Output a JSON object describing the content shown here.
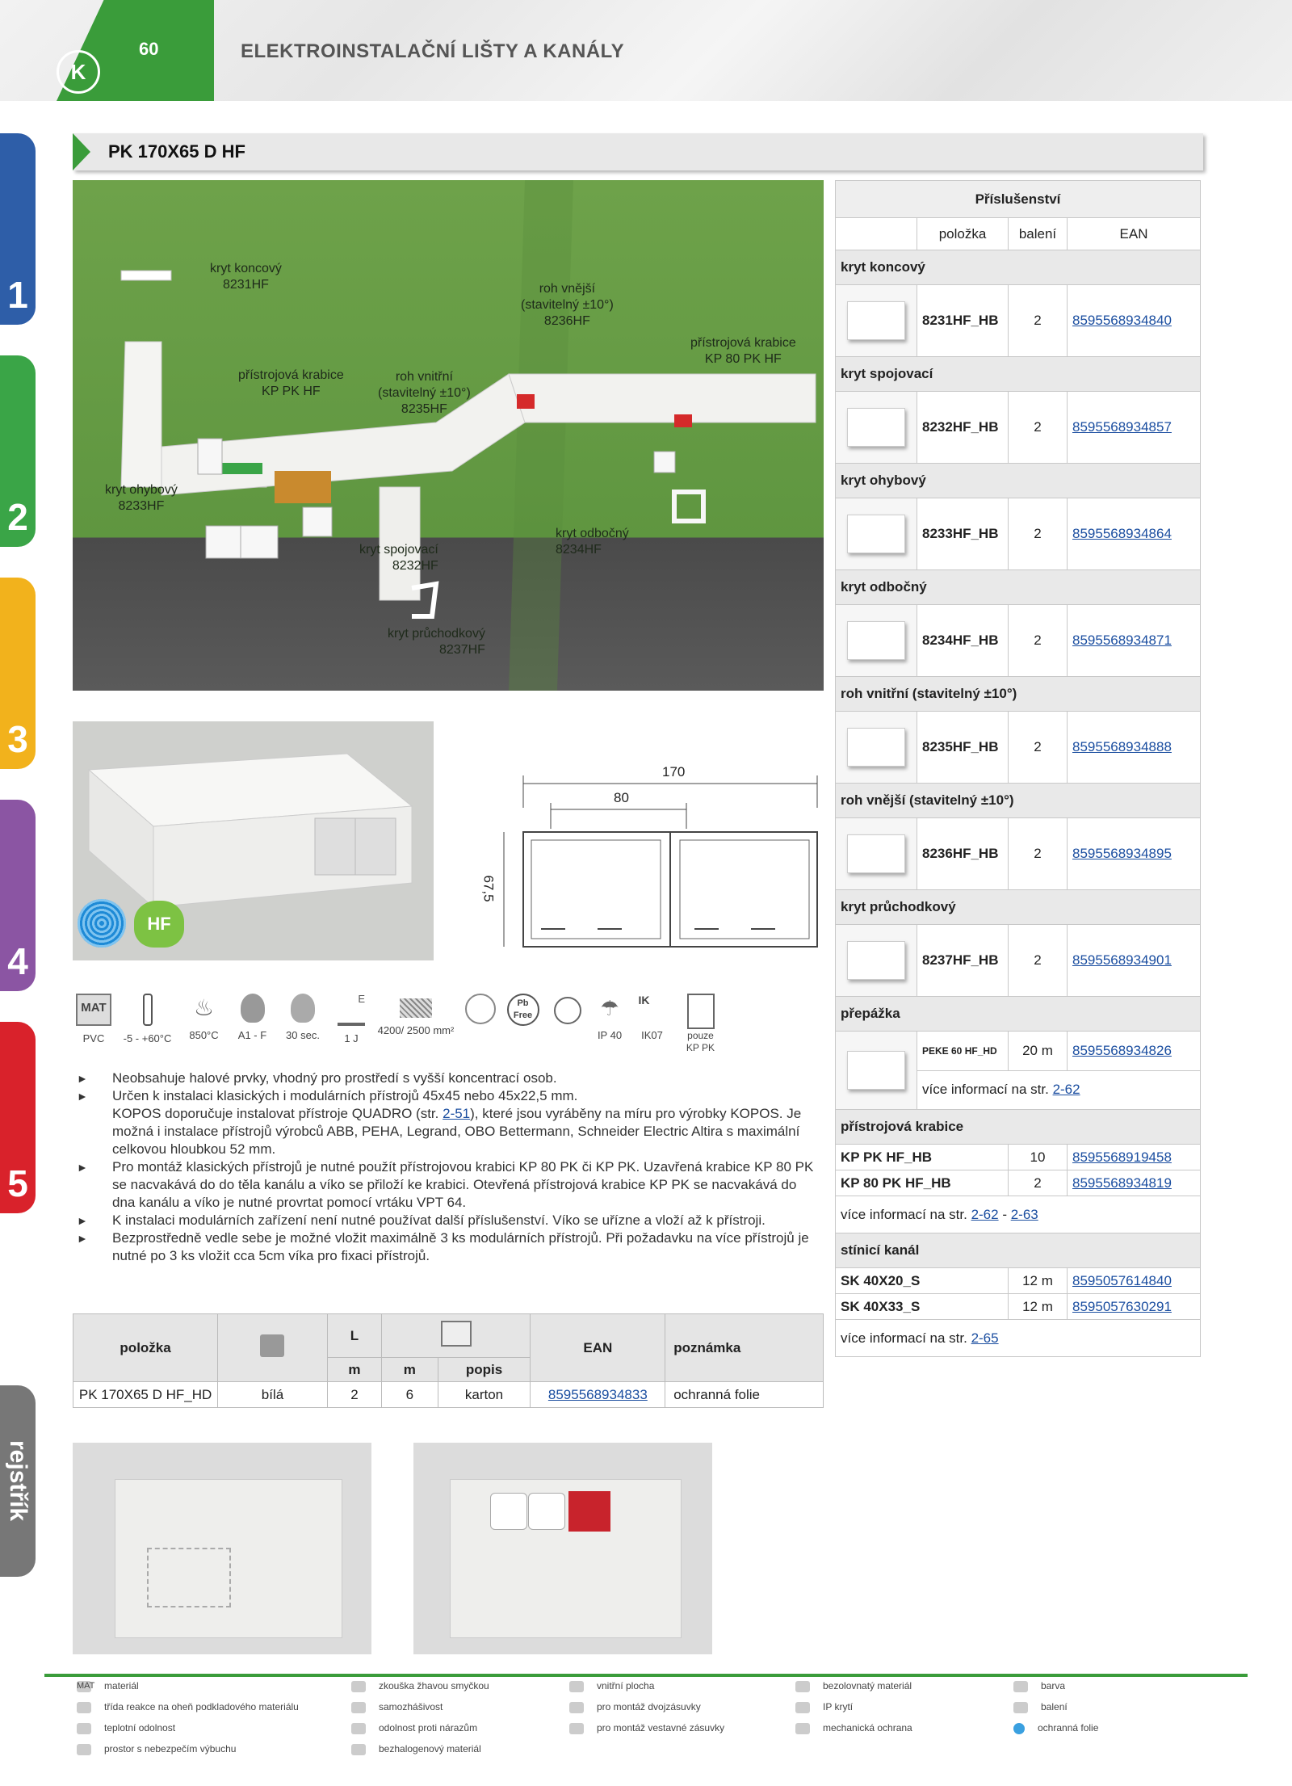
{
  "header": {
    "page_number": "60",
    "title": "ELEKTROINSTALAČNÍ LIŠTY A KANÁLY",
    "logo": "K"
  },
  "side_tabs": [
    "1",
    "2",
    "3",
    "4",
    "5",
    "rejstřík"
  ],
  "product_title": "PK 170X65 D HF",
  "main_image_labels": {
    "kryt_koncovy": "kryt koncový\n8231HF",
    "roh_vnejsi": "roh vnější\n(stavitelný ±10°)\n8236HF",
    "pristrojova_krabice_kp80": "přístrojová krabice\nKP 80 PK HF",
    "pristrojova_krabice_kppk": "přístrojová krabice\nKP PK HF",
    "roh_vnitrni": "roh vnitřní\n(stavitelný ±10°)\n8235HF",
    "kryt_ohybovy": "kryt ohybový\n8233HF",
    "kryt_odbocny": "kryt odbočný\n8234HF",
    "kryt_spojovaci": "kryt spojovací\n8232HF",
    "kryt_pruchodkovy": "kryt průchodkový\n8237HF"
  },
  "badges": {
    "hf": "HF"
  },
  "drawing": {
    "width": "170",
    "inner": "80",
    "height": "67,5"
  },
  "properties": [
    {
      "icon": "material-icon",
      "text": "MAT",
      "label": "PVC"
    },
    {
      "icon": "thermometer-icon",
      "label": "-5 - +60°C"
    },
    {
      "icon": "glow-wire-icon",
      "label": "850°C"
    },
    {
      "icon": "flame-reaction-icon",
      "label": "A1 - F"
    },
    {
      "icon": "self-extinguishing-icon",
      "label": "30 sec."
    },
    {
      "icon": "impact-icon",
      "text": "E",
      "label": "1 J"
    },
    {
      "icon": "inner-area-icon",
      "label": "4200/ 2500 mm²"
    },
    {
      "icon": "socket-mount-icon",
      "label": ""
    },
    {
      "icon": "lead-free-icon",
      "text": "Pb Free",
      "label": ""
    },
    {
      "icon": "explosion-icon",
      "label": ""
    },
    {
      "icon": "ip-icon",
      "label": "IP 40"
    },
    {
      "icon": "mechanical-protection-icon",
      "text": "IK",
      "label": "IK07"
    },
    {
      "icon": "double-socket-icon",
      "label": "pouze\nKP PK"
    }
  ],
  "bullets": [
    {
      "text": "Neobsahuje halové prvky, vhodný pro prostředí s vyšší koncentrací osob."
    },
    {
      "text": "Určen k instalaci klasických i modulárních přístrojů 45x45 nebo 45x22,5 mm.\nKOPOS doporučuje instalovat přístroje  QUADRO (str. ",
      "link": "2-51",
      "text2": "), které jsou vyráběny na míru pro výrobky KOPOS. Je možná i instalace přístrojů výrobců ABB, PEHA, Legrand, OBO Bettermann, Schneider Electric Altira s maximální celkovou hloubkou 52 mm."
    },
    {
      "text": "Pro montáž klasických přístrojů je nutné použít přístrojovou krabici KP 80 PK či KP PK. Uzavřená krabice KP 80 PK se nacvakává do do těla kanálu a víko se přiloží ke krabici. Otevřená přístrojová krabice KP PK se nacvakává do dna kanálu a víko je nutné provrtat pomocí vrtáku VPT 64."
    },
    {
      "text": "K instalaci modulárních zařízení není nutné používat další příslušenství. Víko se uřízne a vloží až k přístroji."
    },
    {
      "text": "Bezprostředně vedle sebe je možné vložit maximálně 3 ks modulárních přístrojů. Při požadavku na více přístrojů je nutné po 3 ks vložit cca 5cm víka pro fixaci přístrojů."
    }
  ],
  "order_table": {
    "headers": {
      "polozka": "položka",
      "L": "L",
      "m1": "m",
      "m2": "m",
      "popis": "popis",
      "ean": "EAN",
      "poznamka": "poznámka"
    },
    "row": {
      "polozka": "PK 170X65 D HF_HD",
      "barva": "bílá",
      "L": "2",
      "baleni": "6",
      "popis": "karton",
      "ean": "8595568934833",
      "poznamka": "ochranná folie"
    }
  },
  "accessories": {
    "title": "Příslušenství",
    "headers": {
      "polozka": "položka",
      "baleni": "balení",
      "ean": "EAN"
    },
    "sections": [
      {
        "name": "kryt koncový",
        "code": "8231HF_HB",
        "qty": "2",
        "ean": "8595568934840"
      },
      {
        "name": "kryt spojovací",
        "code": "8232HF_HB",
        "qty": "2",
        "ean": "8595568934857"
      },
      {
        "name": "kryt ohybový",
        "code": "8233HF_HB",
        "qty": "2",
        "ean": "8595568934864"
      },
      {
        "name": "kryt odbočný",
        "code": "8234HF_HB",
        "qty": "2",
        "ean": "8595568934871"
      },
      {
        "name": "roh vnitřní (stavitelný ±10°)",
        "code": "8235HF_HB",
        "qty": "2",
        "ean": "8595568934888"
      },
      {
        "name": "roh vnější (stavitelný ±10°)",
        "code": "8236HF_HB",
        "qty": "2",
        "ean": "8595568934895"
      },
      {
        "name": "kryt průchodkový",
        "code": "8237HF_HB",
        "qty": "2",
        "ean": "8595568934901"
      }
    ],
    "prepazka": {
      "name": "přepážka",
      "code": "PEKE 60 HF_HD",
      "qty": "20 m",
      "ean": "8595568934826",
      "more": "více informací na str. ",
      "more_link": "2-62"
    },
    "pristrojova": {
      "name": "přístrojová krabice",
      "rows": [
        {
          "code": "KP PK HF_HB",
          "qty": "10",
          "ean": "8595568919458"
        },
        {
          "code": "KP 80 PK HF_HB",
          "qty": "2",
          "ean": "8595568934819"
        }
      ],
      "more": "více informací na str. ",
      "link1": "2-62",
      "sep": " - ",
      "link2": "2-63"
    },
    "stinici": {
      "name": "stínicí kanál",
      "rows": [
        {
          "code": "SK 40X20_S",
          "qty": "12 m",
          "ean": "8595057614840"
        },
        {
          "code": "SK 40X33_S",
          "qty": "12 m",
          "ean": "8595057630291"
        }
      ],
      "more": "více informací na str. ",
      "link": "2-65"
    }
  },
  "legend": [
    {
      "icon": "material-icon",
      "text": "MAT",
      "label": "materiál"
    },
    {
      "icon": "flame-reaction-icon",
      "label": "třída reakce na oheň podkladového materiálu"
    },
    {
      "icon": "thermometer-icon",
      "label": "teplotní odolnost"
    },
    {
      "icon": "explosion-icon",
      "label": "prostor s nebezpečím výbuchu"
    },
    {
      "icon": "glow-wire-icon",
      "label": "zkouška žhavou smyčkou"
    },
    {
      "icon": "self-extinguishing-icon",
      "label": "samozhášivost"
    },
    {
      "icon": "impact-icon",
      "label": "odolnost proti nárazům"
    },
    {
      "icon": "halogen-free-icon",
      "label": "bezhalogenový materiál"
    },
    {
      "icon": "inner-area-icon",
      "label": "vnitřní plocha"
    },
    {
      "icon": "double-socket-icon",
      "label": "pro montáž dvojzásuvky"
    },
    {
      "icon": "socket-mount-icon",
      "label": "pro montáž vestavné zásuvky"
    },
    {
      "icon": "lead-free-icon",
      "label": "bezolovnatý materiál"
    },
    {
      "icon": "ip-icon",
      "label": "IP krytí"
    },
    {
      "icon": "mechanical-protection-icon",
      "label": "mechanická ochrana"
    },
    {
      "icon": "color-icon",
      "label": "barva"
    },
    {
      "icon": "packaging-icon",
      "label": "balení"
    },
    {
      "icon": "protective-foil-icon",
      "label": "ochranná folie"
    }
  ]
}
